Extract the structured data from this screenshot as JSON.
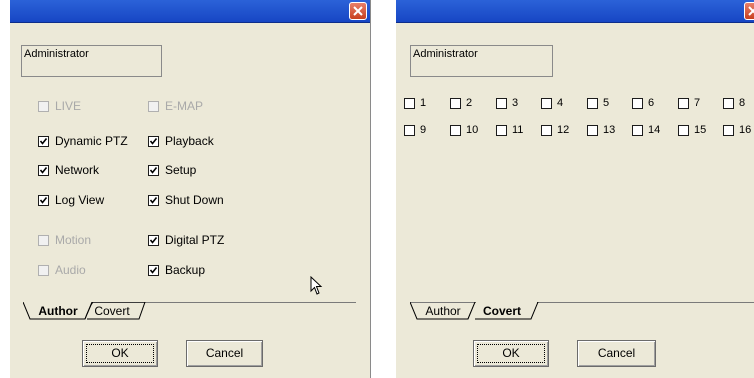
{
  "left_dialog": {
    "user_name": "Administrator",
    "permissions": [
      {
        "label": "LIVE",
        "checked": false,
        "enabled": false
      },
      {
        "label": "E-MAP",
        "checked": false,
        "enabled": false
      },
      {
        "label": "Dynamic PTZ",
        "checked": true,
        "enabled": true
      },
      {
        "label": "Playback",
        "checked": true,
        "enabled": true
      },
      {
        "label": "Network",
        "checked": true,
        "enabled": true
      },
      {
        "label": "Setup",
        "checked": true,
        "enabled": true
      },
      {
        "label": "Log View",
        "checked": true,
        "enabled": true
      },
      {
        "label": "Shut Down",
        "checked": true,
        "enabled": true
      },
      {
        "label": "Motion",
        "checked": false,
        "enabled": false
      },
      {
        "label": "Digital PTZ",
        "checked": true,
        "enabled": true
      },
      {
        "label": "Audio",
        "checked": false,
        "enabled": false
      },
      {
        "label": "Backup",
        "checked": true,
        "enabled": true
      }
    ],
    "tabs": [
      "Author",
      "Covert"
    ],
    "active_tab": "Author",
    "ok_label": "OK",
    "cancel_label": "Cancel"
  },
  "right_dialog": {
    "user_name": "Administrator",
    "channels": [
      "1",
      "2",
      "3",
      "4",
      "5",
      "6",
      "7",
      "8",
      "9",
      "10",
      "11",
      "12",
      "13",
      "14",
      "15",
      "16"
    ],
    "channels_checked": [
      false,
      false,
      false,
      false,
      false,
      false,
      false,
      false,
      false,
      false,
      false,
      false,
      false,
      false,
      false,
      false
    ],
    "tabs": [
      "Author",
      "Covert"
    ],
    "active_tab": "Covert",
    "ok_label": "OK",
    "cancel_label": "Cancel"
  },
  "colors": {
    "dialog_bg": "#ece9d8",
    "titlebar": "#1746c4",
    "close_button": "#c8401f",
    "disabled_text": "#a9a9a9"
  },
  "icons": [
    "close-icon",
    "checkmark-icon",
    "mouse-pointer-icon"
  ]
}
